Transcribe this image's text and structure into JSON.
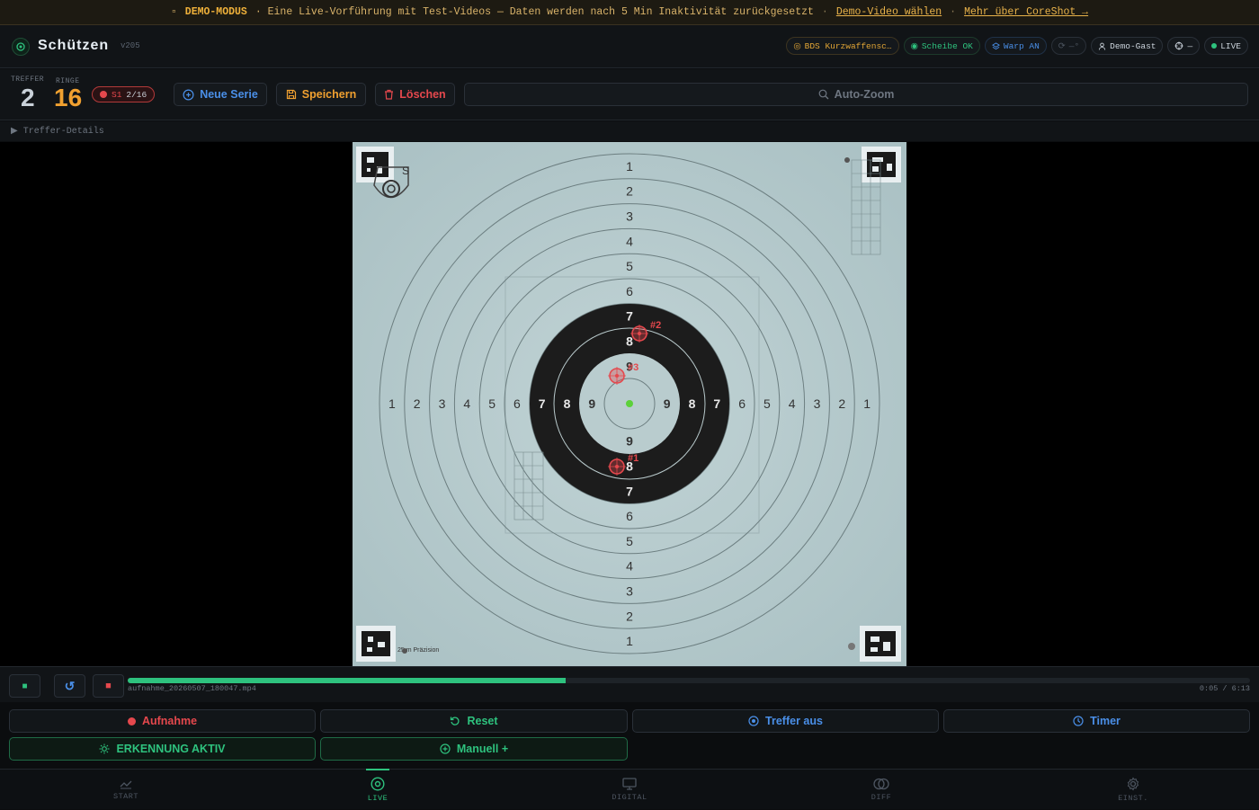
{
  "demo_banner": {
    "label": "DEMO-MODUS",
    "text": "· Eine Live-Vorführung mit Test-Videos — Daten werden nach 5 Min Inaktivität zurückgesetzt",
    "link1": "Demo-Video wählen",
    "link2": "Mehr über CoreShot →"
  },
  "header": {
    "title": "Schützen",
    "version": "v205",
    "chips": {
      "discipline": "BDS Kurzwaffensc…",
      "target_status": "Scheibe OK",
      "warp": "Warp AN",
      "rotation": "—°",
      "user": "Demo-Gast",
      "zoom": "—",
      "live": "LIVE"
    }
  },
  "stats": {
    "hits_label": "TREFFER",
    "hits": "2",
    "rings_label": "RINGE",
    "rings": "16",
    "series_id": "S1",
    "series_progress": "2/16"
  },
  "toolbar": {
    "new_series": "Neue Serie",
    "save": "Speichern",
    "delete": "Löschen",
    "auto_zoom": "Auto-Zoom"
  },
  "details_toggle": "▶ Treffer-Details",
  "target": {
    "ring_numbers": [
      "1",
      "2",
      "3",
      "4",
      "5",
      "6",
      "7",
      "8",
      "9"
    ],
    "caption": "25 m Präzision",
    "logo_letter": "S",
    "shots": [
      {
        "label": "#2",
        "ring": 8
      },
      {
        "label": "#3",
        "ring": 9
      },
      {
        "label": "#1",
        "ring": 8
      }
    ]
  },
  "player": {
    "filename": "aufnahme_20260507_180047.mp4",
    "time": "0:05 / 6:13",
    "progress": 0.39
  },
  "actions": {
    "record": "Aufnahme",
    "reset": "Reset",
    "hits_off": "Treffer aus",
    "timer": "Timer",
    "detection": "ERKENNUNG AKTIV",
    "manual": "Manuell +"
  },
  "nav": {
    "start": "START",
    "live": "LIVE",
    "digital": "DIGITAL",
    "diff": "DIFF",
    "settings": "EINST."
  },
  "colors": {
    "accent_green": "#2ec27e",
    "accent_red": "#e5484d",
    "accent_amber": "#f0a030",
    "accent_blue": "#4a8fe8"
  }
}
